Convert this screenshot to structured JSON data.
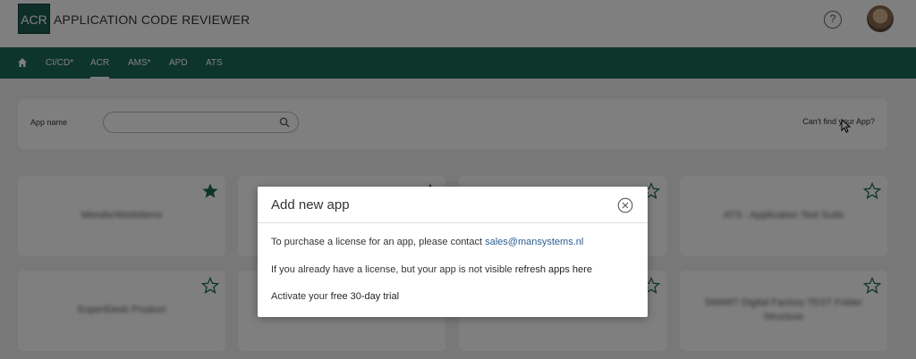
{
  "header": {
    "logo_text": "ACR",
    "app_title": "APPLICATION CODE REVIEWER",
    "help_label": "?"
  },
  "nav": {
    "items": [
      {
        "label": "CI/CD*"
      },
      {
        "label": "ACR",
        "active": true
      },
      {
        "label": "AMS*"
      },
      {
        "label": "APD"
      },
      {
        "label": "ATS"
      }
    ]
  },
  "search": {
    "label": "App name",
    "value": "",
    "placeholder": "",
    "cant_find": "Can't find your App?"
  },
  "cards": [
    {
      "name": "Mendix/WorkItems",
      "favorite": true
    },
    {
      "name": "",
      "favorite": true
    },
    {
      "name": "",
      "favorite": false
    },
    {
      "name": "ATS - Application Test Suite",
      "favorite": false
    },
    {
      "name": "ExpertDesk Product",
      "favorite": false
    },
    {
      "name": "",
      "favorite": false
    },
    {
      "name": "",
      "favorite": false
    },
    {
      "name": "SMART Digital Factory TEST Folder Structure",
      "favorite": false
    }
  ],
  "modal": {
    "title": "Add new app",
    "line1_text": "To purchase a license for an app, please contact ",
    "line1_link": "sales@mansystems.nl",
    "line2_text": "If you already have a license, but your app is not visible ",
    "line2_link": "refresh apps here",
    "line3_text": "Activate your ",
    "line3_link": "free 30-day trial"
  },
  "colors": {
    "brand": "#1d6b59",
    "star_filled": "#1d6b59",
    "link": "#2a5d8f"
  }
}
